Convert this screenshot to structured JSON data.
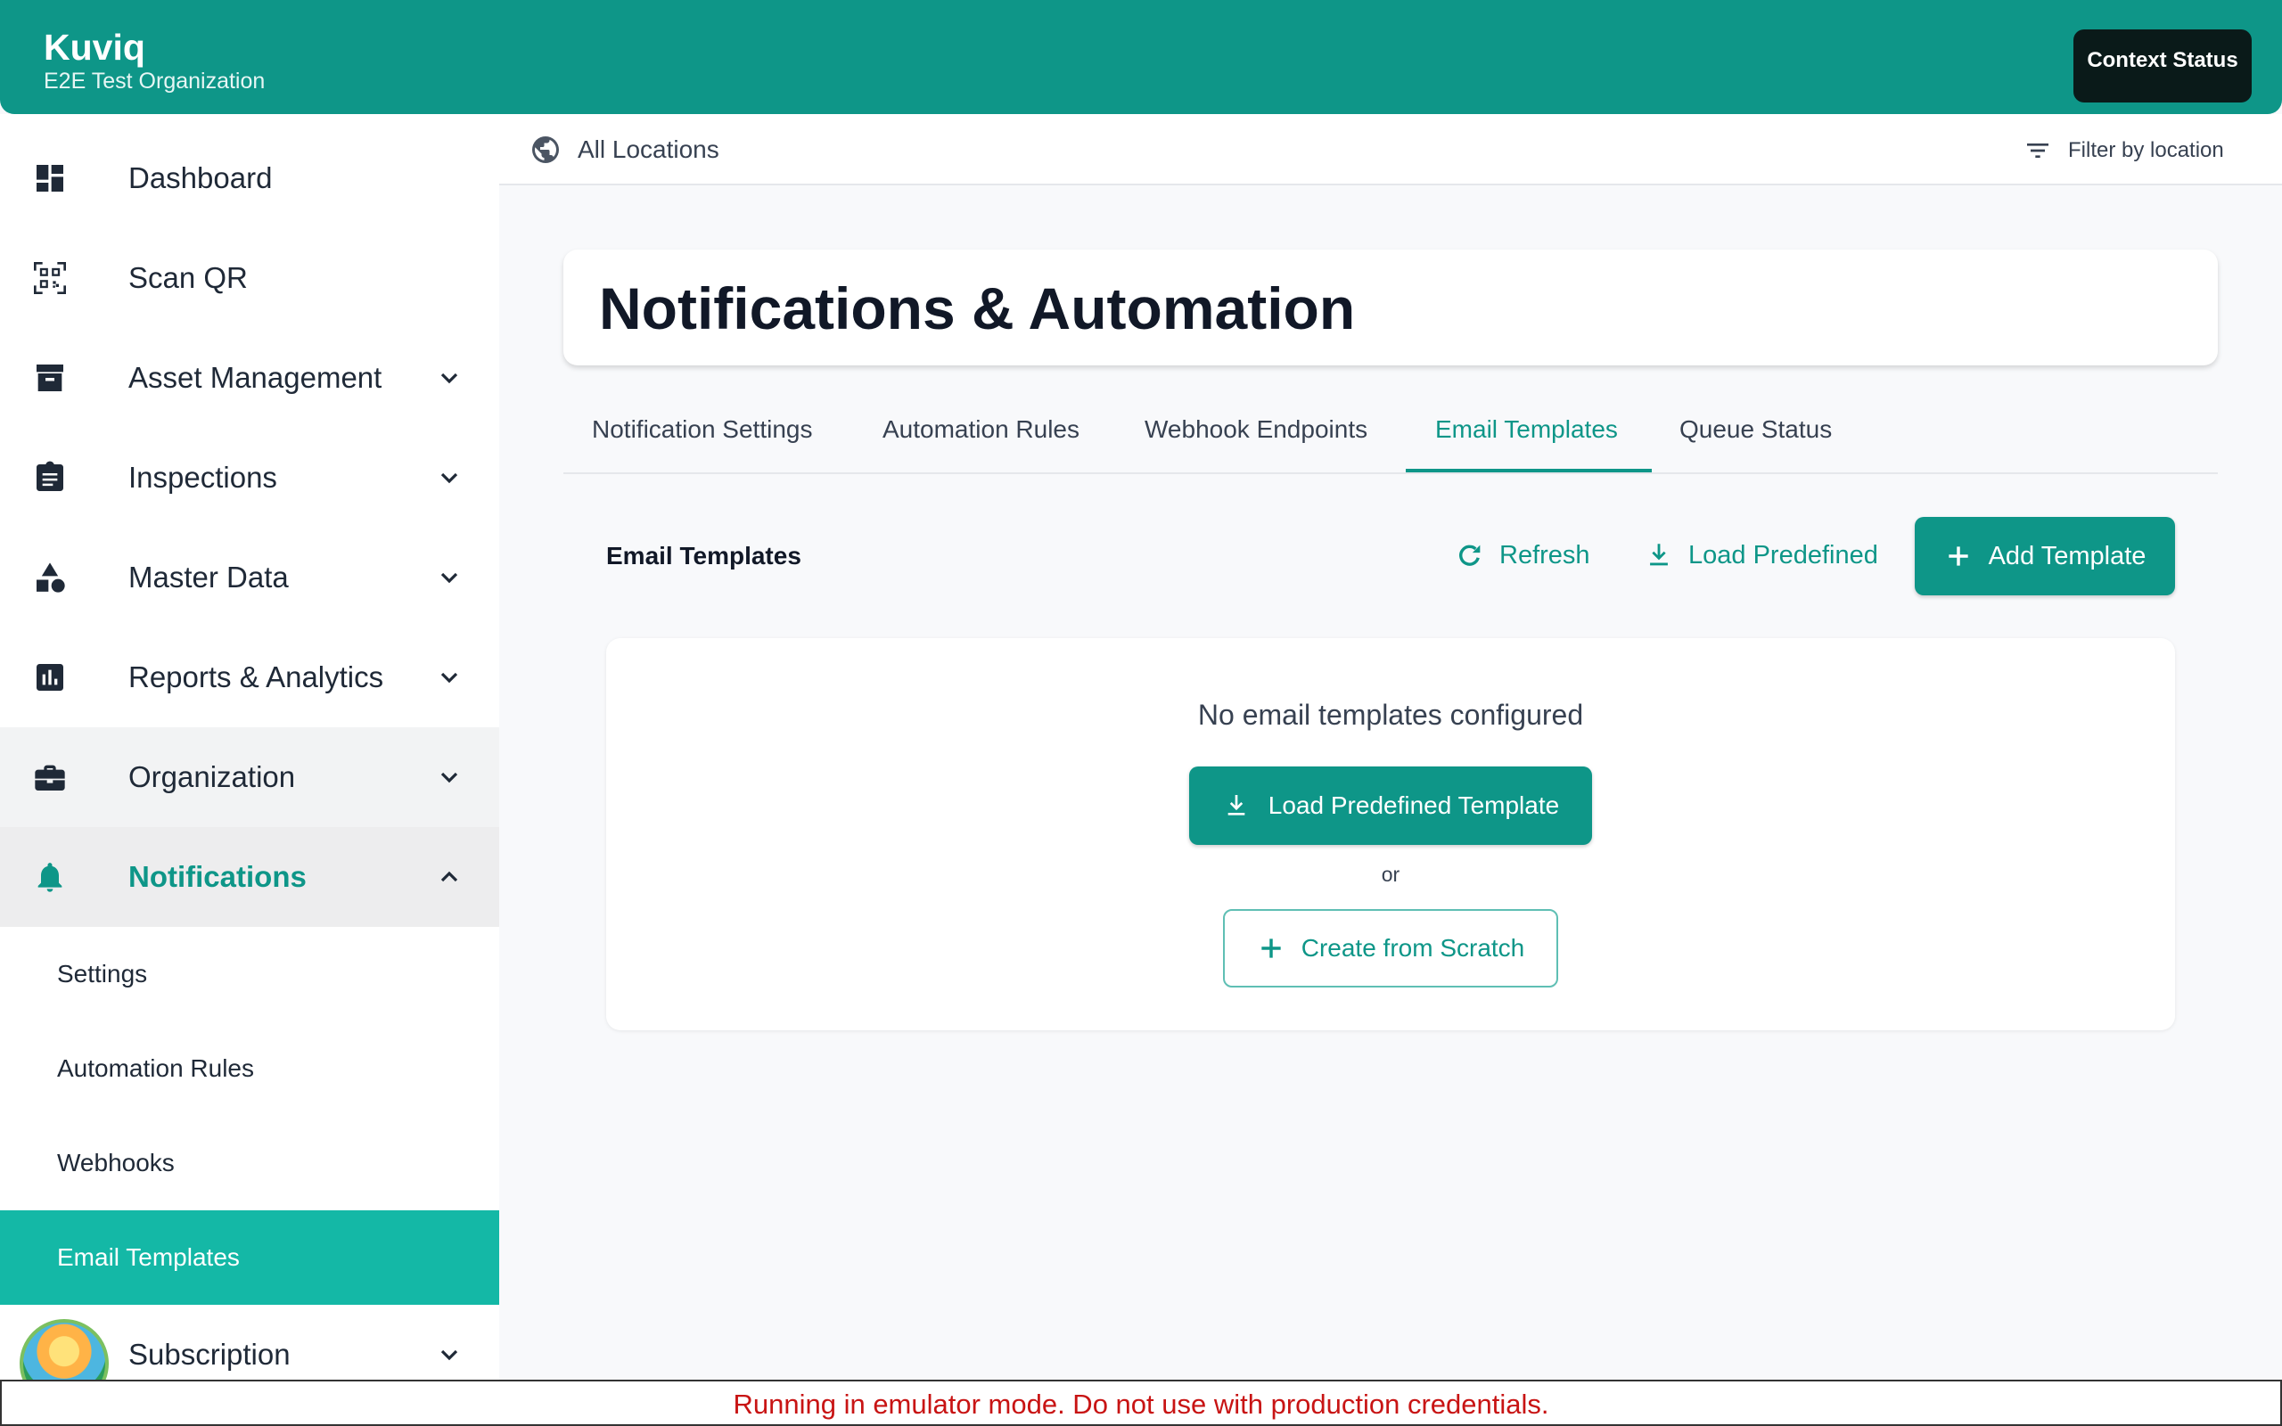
{
  "header": {
    "app_name": "Kuviq",
    "org_name": "E2E Test Organization",
    "context_status_label": "Context Status"
  },
  "sidebar": {
    "items": [
      {
        "label": "Dashboard",
        "icon": "dashboard-icon"
      },
      {
        "label": "Scan QR",
        "icon": "qr-scan-icon"
      },
      {
        "label": "Asset Management",
        "icon": "archive-icon"
      },
      {
        "label": "Inspections",
        "icon": "clipboard-icon"
      },
      {
        "label": "Master Data",
        "icon": "shapes-icon"
      },
      {
        "label": "Reports & Analytics",
        "icon": "bar-chart-icon"
      },
      {
        "label": "Organization",
        "icon": "briefcase-icon"
      },
      {
        "label": "Notifications",
        "icon": "bell-icon"
      }
    ],
    "sub_items": [
      "Settings",
      "Automation Rules",
      "Webhooks",
      "Email Templates"
    ],
    "active_sub_item": "Email Templates",
    "last_item": {
      "label": "Subscription"
    }
  },
  "location_bar": {
    "location_label": "All Locations",
    "filter_label": "Filter by location"
  },
  "main": {
    "page_title": "Notifications & Automation",
    "tabs": [
      "Notification Settings",
      "Automation Rules",
      "Webhook Endpoints",
      "Email Templates",
      "Queue Status"
    ],
    "active_tab": "Email Templates",
    "section_title": "Email Templates",
    "refresh_label": "Refresh",
    "load_predefined_label": "Load Predefined",
    "add_template_label": "Add Template",
    "empty_message": "No email templates configured",
    "load_predefined_template_label": "Load Predefined Template",
    "or_label": "or",
    "create_from_scratch_label": "Create from Scratch"
  },
  "banner": {
    "text": "Running in emulator mode. Do not use with production credentials."
  },
  "colors": {
    "accent": "#0e9688",
    "active_sub_bg": "#14b8a6",
    "banner_text": "#c81414"
  }
}
